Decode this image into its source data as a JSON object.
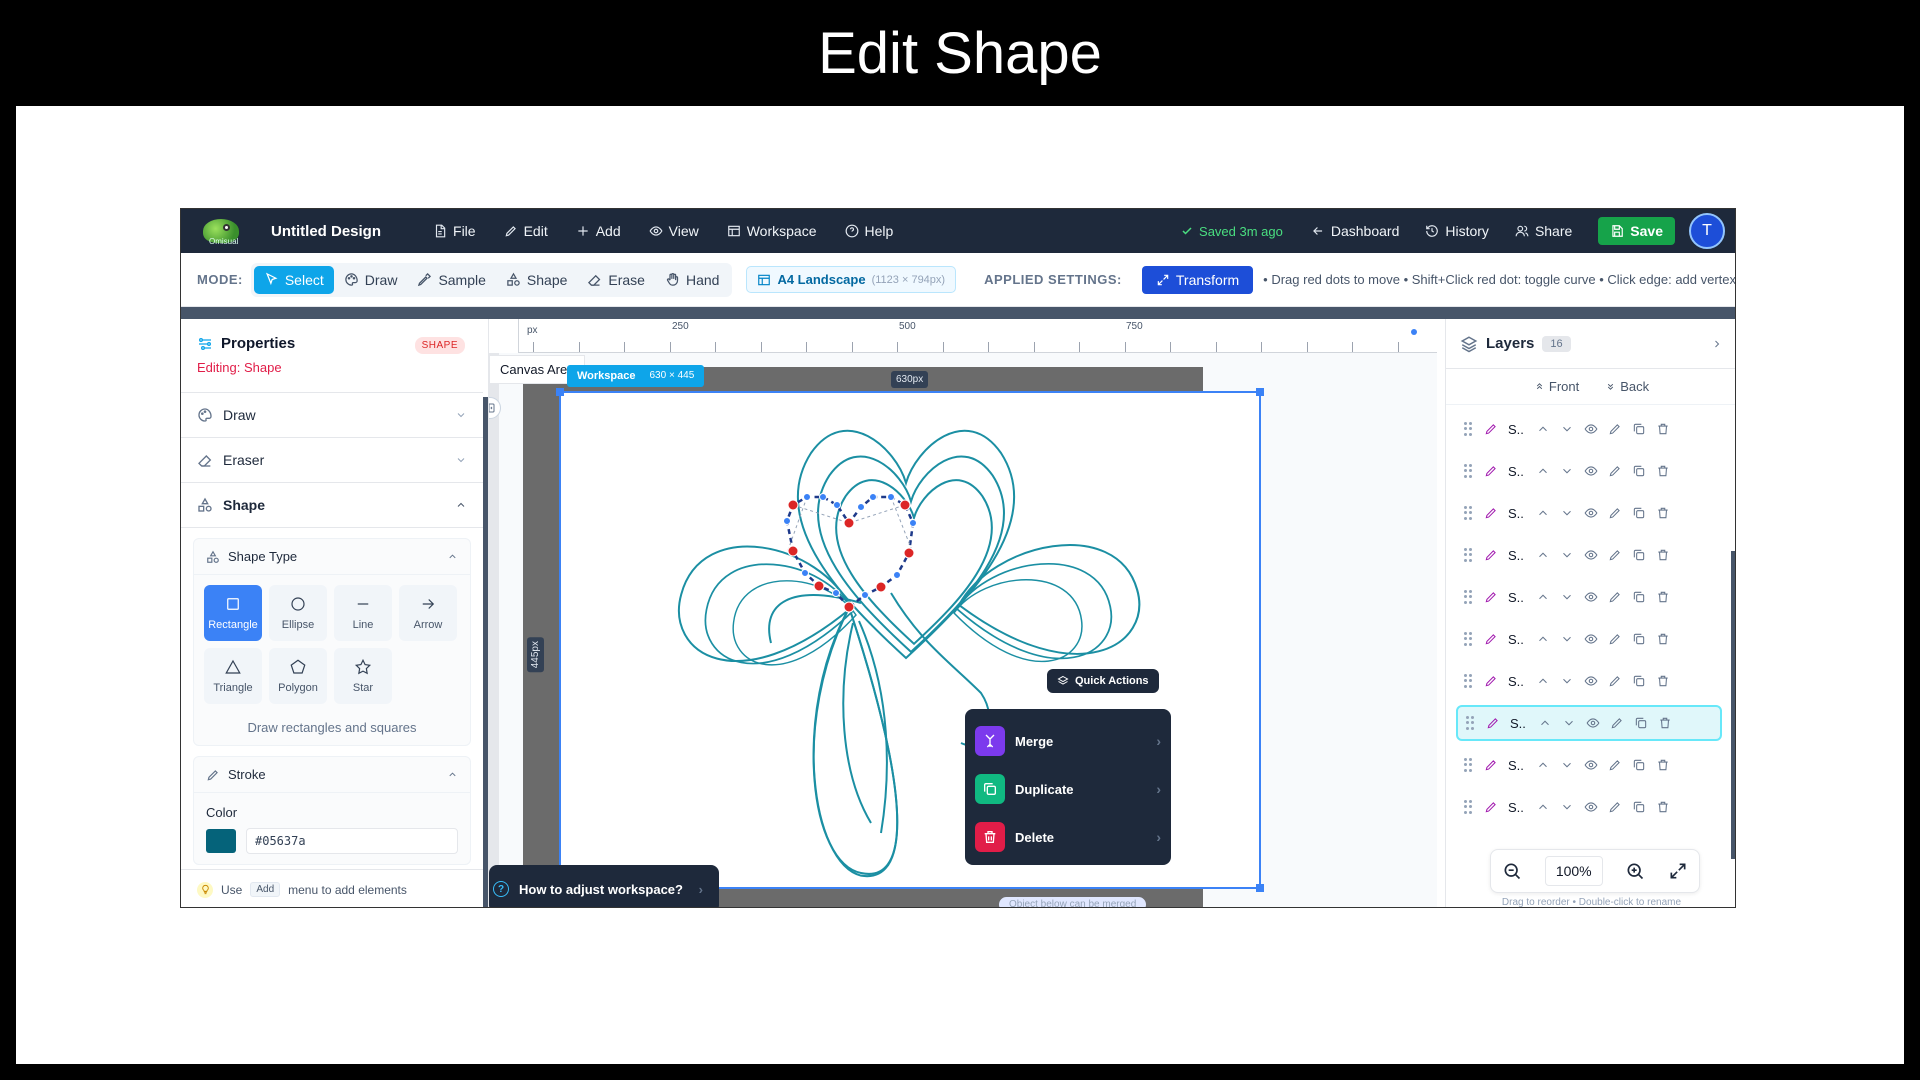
{
  "page_title": "Edit Shape",
  "topbar": {
    "app_title": "Untitled Design",
    "menu": [
      {
        "label": "File",
        "icon": "file-icon"
      },
      {
        "label": "Edit",
        "icon": "pencil-icon"
      },
      {
        "label": "Add",
        "icon": "plus-icon"
      },
      {
        "label": "View",
        "icon": "eye-icon"
      },
      {
        "label": "Workspace",
        "icon": "layout-icon"
      },
      {
        "label": "Help",
        "icon": "help-circle-icon"
      }
    ],
    "saved": "Saved 3m ago",
    "dashboard": "Dashboard",
    "history": "History",
    "share": "Share",
    "save": "Save",
    "avatar_initial": "T",
    "logo_text": "Omisual"
  },
  "modebar": {
    "mode_label": "MODE:",
    "modes": [
      {
        "label": "Select",
        "icon": "cursor-icon",
        "active": true
      },
      {
        "label": "Draw",
        "icon": "palette-icon",
        "active": false
      },
      {
        "label": "Sample",
        "icon": "eyedropper-icon",
        "active": false
      },
      {
        "label": "Shape",
        "icon": "shapes-icon",
        "active": false
      },
      {
        "label": "Erase",
        "icon": "eraser-icon",
        "active": false
      },
      {
        "label": "Hand",
        "icon": "hand-icon",
        "active": false
      }
    ],
    "paper_label": "A4 Landscape",
    "paper_dims": "(1123 × 794px)",
    "applied_label": "APPLIED SETTINGS:",
    "transform_label": "Transform",
    "hint": "• Drag red dots to move • Shift+Click red dot: toggle curve • Click edge: add vertex"
  },
  "properties": {
    "title": "Properties",
    "badge": "SHAPE",
    "editing": "Editing: Shape",
    "sections": {
      "draw": "Draw",
      "eraser": "Eraser",
      "shape": "Shape"
    },
    "shape_type_title": "Shape Type",
    "shape_types": [
      {
        "label": "Rectangle",
        "active": true
      },
      {
        "label": "Ellipse",
        "active": false
      },
      {
        "label": "Line",
        "active": false
      },
      {
        "label": "Arrow",
        "active": false
      },
      {
        "label": "Triangle",
        "active": false
      },
      {
        "label": "Polygon",
        "active": false
      },
      {
        "label": "Star",
        "active": false
      }
    ],
    "shape_desc": "Draw rectangles and squares",
    "stroke_title": "Stroke",
    "color_label": "Color",
    "color_hex": "#05637a",
    "tip_use": "Use",
    "tip_key": "Add",
    "tip_rest": "menu to add elements"
  },
  "canvas": {
    "ruler_unit": "px",
    "ruler_labels": [
      "250",
      "500",
      "750"
    ],
    "canvas_area": "Canvas Area",
    "workspace_label": "Workspace",
    "workspace_dims": "630 × 445",
    "width_badge": "630px",
    "height_badge": "445px",
    "quick_actions": "Quick Actions",
    "actions": [
      {
        "label": "Merge",
        "color": "#7c3aed"
      },
      {
        "label": "Duplicate",
        "color": "#10b981"
      },
      {
        "label": "Delete",
        "color": "#e11d48"
      }
    ],
    "help_text": "How to adjust workspace?",
    "merge_hint": "Object below can be merged",
    "stroke_color": "#1b8fa3",
    "handle_color": "#dc2626",
    "point_color": "#3b82f6"
  },
  "layers": {
    "title": "Layers",
    "count": "16",
    "front": "Front",
    "back": "Back",
    "items": [
      "S..",
      "S..",
      "S..",
      "S..",
      "S..",
      "S..",
      "S..",
      "S..",
      "S..",
      "S.."
    ],
    "selected_index": 7,
    "zoom": "100%",
    "drag_hint": "Drag to reorder • Double-click to rename"
  }
}
